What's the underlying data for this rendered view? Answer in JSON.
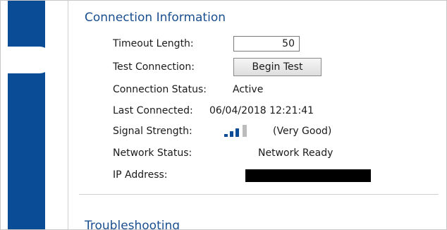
{
  "section_title": "Connection Information",
  "next_section_title": "Troubleshooting",
  "fields": {
    "timeout": {
      "label": "Timeout Length:",
      "value": "50"
    },
    "test_connection": {
      "label": "Test Connection:",
      "button_label": "Begin Test"
    },
    "status": {
      "label": "Connection Status:",
      "value": "Active"
    },
    "last_connected": {
      "label": "Last Connected:",
      "value": "06/04/2018 12:21:41"
    },
    "signal": {
      "label": "Signal Strength:",
      "value": "(Very Good)",
      "bars_total": 4,
      "bars_filled": 3,
      "filled_color": "#0a4d96",
      "empty_color": "#bcbcbc"
    },
    "network_status": {
      "label": "Network Status:",
      "value": "Network Ready"
    },
    "ip_address": {
      "label": "IP Address:",
      "redacted": true,
      "redaction_color": "#000000"
    }
  },
  "colors": {
    "rail": "#0a4d96",
    "title": "#1a4f8f",
    "text": "#1a1a1a"
  }
}
